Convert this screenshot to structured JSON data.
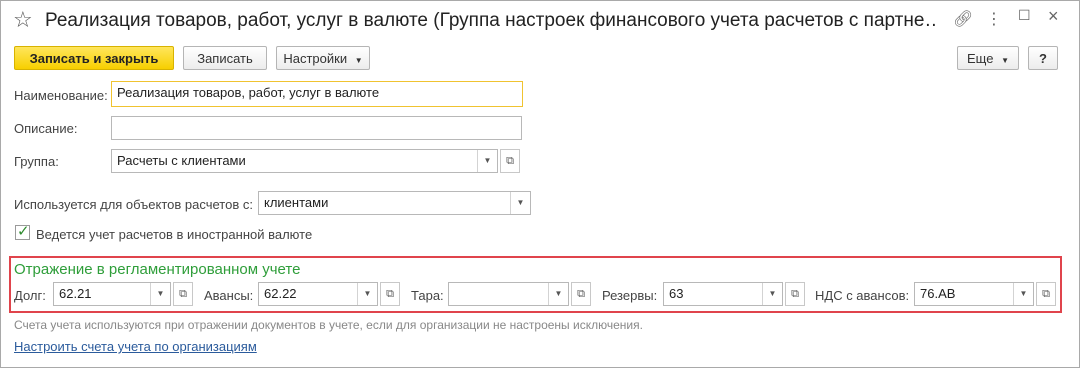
{
  "window": {
    "title": "Реализация товаров, работ, услуг в валюте (Группа настроек финансового учета расчетов с партне…"
  },
  "toolbar": {
    "save_close": "Записать и закрыть",
    "save": "Записать",
    "settings": "Настройки",
    "more": "Еще",
    "help": "?"
  },
  "form": {
    "name_label": "Наименование:",
    "name_value": "Реализация товаров, работ, услуг в валюте",
    "description_label": "Описание:",
    "description_value": "",
    "group_label": "Группа:",
    "group_value": "Расчеты с клиентами",
    "used_for_label": "Используется для объектов расчетов с:",
    "used_for_value": "клиентами",
    "foreign_currency_label": "Ведется учет расчетов в иностранной валюте",
    "foreign_currency_checked": true
  },
  "accounting": {
    "section_title": "Отражение в регламентированном учете",
    "debt_label": "Долг:",
    "debt_value": "62.21",
    "advances_label": "Авансы:",
    "advances_value": "62.22",
    "tare_label": "Тара:",
    "tare_value": "",
    "reserves_label": "Резервы:",
    "reserves_value": "63",
    "vat_label": "НДС с авансов:",
    "vat_value": "76.АВ"
  },
  "footer": {
    "hint": "Счета учета используются при отражении документов в учете, если для организации не настроены исключения.",
    "link": "Настроить счета учета по организациям"
  },
  "colors": {
    "accent_green": "#2f9e3a",
    "highlight_red": "#e0444c",
    "primary_yellow": "#f7cf00",
    "link_blue": "#2b5b9c"
  }
}
